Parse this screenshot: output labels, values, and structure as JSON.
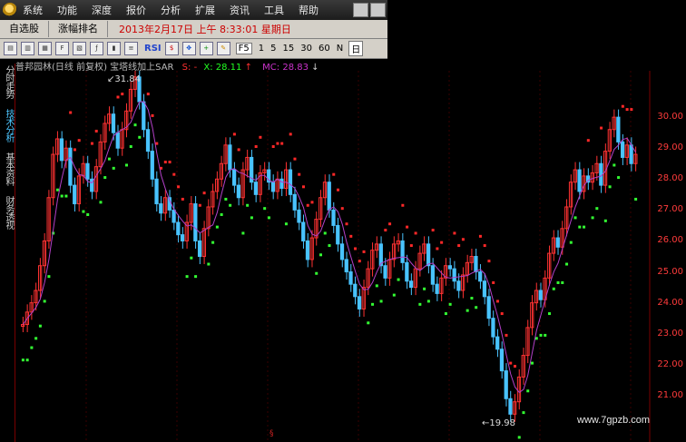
{
  "menu": {
    "items": [
      "系统",
      "功能",
      "深度",
      "报价",
      "分析",
      "扩展",
      "资讯",
      "工具",
      "帮助"
    ]
  },
  "tabs": [
    "自选股",
    "涨幅排名"
  ],
  "datetime": "2013年2月17日 上午 8:33:01 星期日",
  "toolbar": {
    "text_items": [
      "RSI",
      "1",
      "5",
      "15",
      "30",
      "60",
      "N",
      "日"
    ],
    "box_items": [
      "F5"
    ]
  },
  "left_tabs": [
    "分时走势",
    "技术分析",
    "基本资料",
    "财务透视"
  ],
  "indicator": {
    "title": "普邦园林(日线 前复权) 宝塔线加上SAR",
    "sar_label": "S: -",
    "sar_value": "X: 28.11",
    "sar_arrow": "↑",
    "mc_label": "MC: 28.83",
    "mc_arrow": "↓"
  },
  "price_labels": {
    "high": "31.84",
    "low": "19.98"
  },
  "axis": {
    "ticks": [
      "30.00",
      "29.00",
      "28.00",
      "27.00",
      "26.00",
      "25.00",
      "24.00",
      "23.00",
      "22.00",
      "21.00"
    ]
  },
  "watermark": "www.7gpzb.com",
  "colors": {
    "up": "#ff3232",
    "down": "#49c3ff",
    "sar_up": "#33ff33",
    "sar_down": "#ff2828",
    "ma": "#b340c8"
  },
  "chart_data": {
    "type": "candlestick",
    "ylim": [
      19.5,
      31.5
    ],
    "closes": [
      23.3,
      23.7,
      24.0,
      24.4,
      25.2,
      26.0,
      27.4,
      28.8,
      29.3,
      28.6,
      29.0,
      27.8,
      27.2,
      28.1,
      28.5,
      28.0,
      27.6,
      28.4,
      29.2,
      29.8,
      30.1,
      29.5,
      29.0,
      29.6,
      30.2,
      30.9,
      31.3,
      30.5,
      29.6,
      28.9,
      28.0,
      27.2,
      26.9,
      27.4,
      27.0,
      26.6,
      26.2,
      26.0,
      26.6,
      27.2,
      26.0,
      25.5,
      26.4,
      27.1,
      27.6,
      28.0,
      28.5,
      29.1,
      28.3,
      27.8,
      27.4,
      28.3,
      28.7,
      27.9,
      27.5,
      28.2,
      28.3,
      27.9,
      27.6,
      28.0,
      27.7,
      28.3,
      27.5,
      27.0,
      26.6,
      26.0,
      25.4,
      26.1,
      26.7,
      27.4,
      27.9,
      27.0,
      26.5,
      25.9,
      25.4,
      25.0,
      24.6,
      24.2,
      23.8,
      24.5,
      25.1,
      25.7,
      25.9,
      25.2,
      24.8,
      25.4,
      25.9,
      26.0,
      25.3,
      24.7,
      24.5,
      25.1,
      25.6,
      25.9,
      25.2,
      24.6,
      24.3,
      24.8,
      25.2,
      25.1,
      24.7,
      24.4,
      24.9,
      25.3,
      25.5,
      25.0,
      24.7,
      24.2,
      23.5,
      22.9,
      22.5,
      21.8,
      20.9,
      20.4,
      20.8,
      21.6,
      22.3,
      23.2,
      24.0,
      24.4,
      24.1,
      24.8,
      25.6,
      26.1,
      25.8,
      26.4,
      27.1,
      27.9,
      28.3,
      27.6,
      28.1,
      27.9,
      28.2,
      28.5,
      27.8,
      28.9,
      29.6,
      30.0,
      29.2,
      28.7,
      29.1,
      28.5,
      28.8
    ]
  }
}
